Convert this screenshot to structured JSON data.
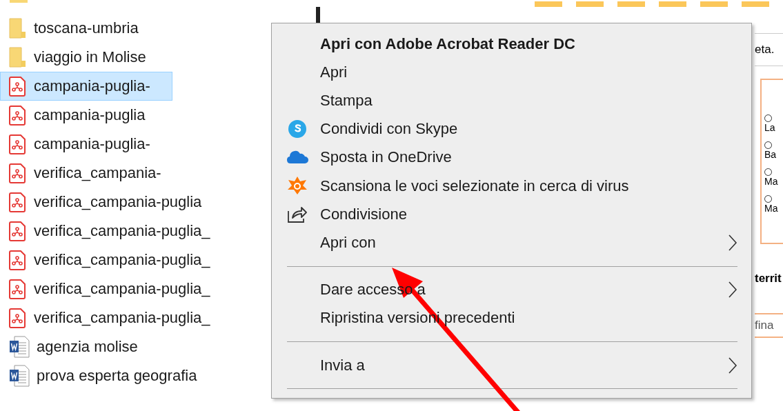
{
  "files": [
    {
      "name": "toscana-umbria",
      "kind": "folder",
      "selected": false
    },
    {
      "name": "viaggio in Molise",
      "kind": "folder",
      "selected": false
    },
    {
      "name": "campania-puglia-",
      "kind": "pdf",
      "selected": true
    },
    {
      "name": "campania-puglia",
      "kind": "pdf",
      "selected": false
    },
    {
      "name": "campania-puglia-",
      "kind": "pdf",
      "selected": false
    },
    {
      "name": "verifica_campania-",
      "kind": "pdf",
      "selected": false
    },
    {
      "name": "verifica_campania-puglia",
      "kind": "pdf",
      "selected": false
    },
    {
      "name": "verifica_campania-puglia_",
      "kind": "pdf",
      "selected": false
    },
    {
      "name": "verifica_campania-puglia_",
      "kind": "pdf",
      "selected": false
    },
    {
      "name": "verifica_campania-puglia_",
      "kind": "pdf",
      "selected": false
    },
    {
      "name": "verifica_campania-puglia_",
      "kind": "pdf",
      "selected": false
    },
    {
      "name": "agenzia molise",
      "kind": "word",
      "selected": false
    },
    {
      "name": "prova esperta geografia",
      "kind": "word",
      "selected": false
    }
  ],
  "document": {
    "header_text": "eta.",
    "entries": [
      "La",
      "Ba",
      "Ma",
      "Ma"
    ],
    "heading": "territ",
    "field_text": "fina"
  },
  "context_menu": [
    {
      "kind": "default",
      "label": "Apri con Adobe Acrobat Reader DC"
    },
    {
      "kind": "plain",
      "label": "Apri"
    },
    {
      "kind": "plain",
      "label": "Stampa"
    },
    {
      "kind": "skype",
      "label": "Condividi con Skype"
    },
    {
      "kind": "onedrive",
      "label": "Sposta in OneDrive"
    },
    {
      "kind": "antivirus",
      "label": "Scansiona le voci selezionate in cerca di virus"
    },
    {
      "kind": "share",
      "label": "Condivisione"
    },
    {
      "kind": "submenu",
      "label": "Apri con"
    },
    {
      "kind": "separator"
    },
    {
      "kind": "submenu",
      "label": "Dare accesso a"
    },
    {
      "kind": "plain",
      "label": "Ripristina versioni precedenti"
    },
    {
      "kind": "separator"
    },
    {
      "kind": "submenu",
      "label": "Invia a"
    },
    {
      "kind": "separator"
    }
  ]
}
